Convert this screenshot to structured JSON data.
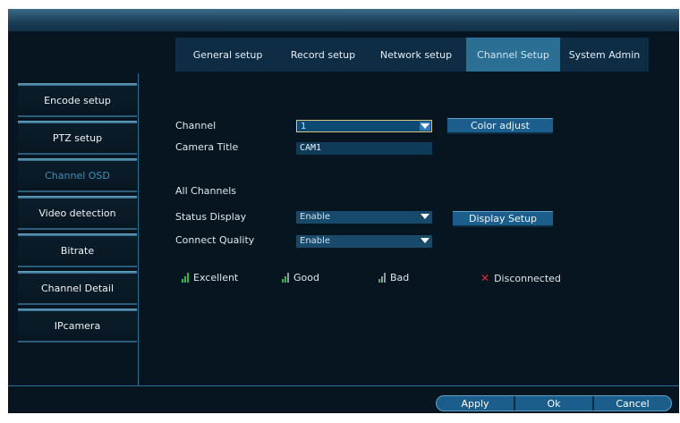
{
  "tabs": [
    "General setup",
    "Record setup",
    "Network setup",
    "Channel Setup",
    "System Admin"
  ],
  "sidebar": [
    "Encode setup",
    "PTZ setup",
    "Channel OSD",
    "Video detection",
    "Bitrate",
    "Channel Detail",
    "IPcamera"
  ],
  "form": {
    "channel_label": "Channel",
    "channel_value": "1",
    "color_adjust_label": "Color adjust",
    "camera_title_label": "Camera Title",
    "camera_title_value": "CAM1",
    "all_channels_label": "All Channels",
    "status_display_label": "Status Display",
    "status_display_value": "Enable",
    "display_setup_label": "Display Setup",
    "connect_quality_label": "Connect Quality",
    "connect_quality_value": "Enable"
  },
  "legend": {
    "excellent": "Excellent",
    "good": "Good",
    "bad": "Bad",
    "disconnected": "Disconnected"
  },
  "footer": {
    "apply": "Apply",
    "ok": "Ok",
    "cancel": "Cancel"
  },
  "colors": {
    "active_tab": "#2b6f95",
    "signal_green": "#2fb84a",
    "signal_gray": "#8b9aa3",
    "disconnected_red": "#e0283a"
  }
}
